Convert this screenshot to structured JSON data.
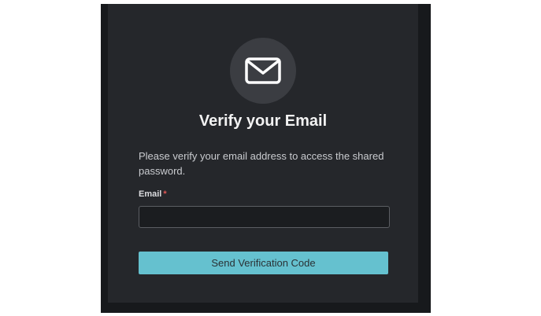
{
  "dialog": {
    "title": "Verify your Email",
    "description": "Please verify your email address to access the shared password.",
    "icon": "envelope-icon"
  },
  "form": {
    "email_label": "Email",
    "required_marker": "*",
    "email_value": "",
    "email_placeholder": ""
  },
  "actions": {
    "send_label": "Send Verification Code"
  },
  "colors": {
    "frame_background": "#17191c",
    "card_background": "#25272b",
    "icon_circle": "#3b3d42",
    "button_accent": "#65c1cf",
    "required_red": "#e05555"
  }
}
